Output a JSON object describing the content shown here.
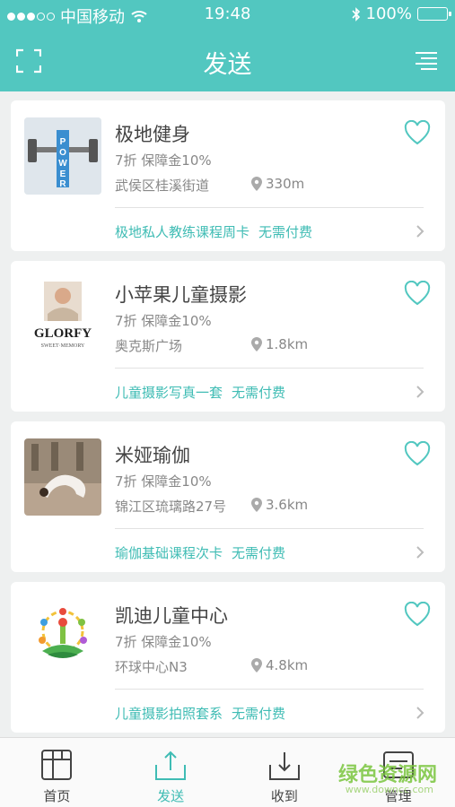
{
  "status_bar": {
    "carrier": "中国移动",
    "time": "19:48",
    "battery": "100%"
  },
  "header": {
    "title": "发送",
    "scan_icon": "scan-icon",
    "menu_icon": "menu-icon"
  },
  "colors": {
    "accent": "#52c7c0",
    "link": "#3fbcb4",
    "heart": "#52c7c0"
  },
  "merchants": [
    {
      "name": "极地健身",
      "discount": "7折  保障金10%",
      "address": "武侯区桂溪街道",
      "distance": "330m",
      "offer": "极地私人教练课程周卡",
      "fee": "无需付费",
      "thumb": "power-logo"
    },
    {
      "name": "小苹果儿童摄影",
      "discount": "7折  保障金10%",
      "address": "奥克斯广场",
      "distance": "1.8km",
      "offer": "儿童摄影写真一套",
      "fee": "无需付费",
      "thumb": "glorfy-logo",
      "thumb_text": "GLORFY",
      "thumb_sub": "SWEET·MEMORY"
    },
    {
      "name": "米娅瑜伽",
      "discount": "7折  保障金10%",
      "address": "锦江区琉璃路27号",
      "distance": "3.6km",
      "offer": "瑜伽基础课程次卡",
      "fee": "无需付费",
      "thumb": "yoga-photo"
    },
    {
      "name": "凯迪儿童中心",
      "discount": "7折  保障金10%",
      "address": "环球中心N3",
      "distance": "4.8km",
      "offer": "儿童摄影拍照套系",
      "fee": "无需付费",
      "thumb": "kids-logo"
    }
  ],
  "tabs": [
    {
      "label": "首页",
      "icon": "home-icon",
      "active": false
    },
    {
      "label": "发送",
      "icon": "send-icon",
      "active": true
    },
    {
      "label": "收到",
      "icon": "receive-icon",
      "active": false
    },
    {
      "label": "管理",
      "icon": "manage-icon",
      "active": false
    }
  ],
  "watermark": {
    "text": "绿色资源网",
    "sub": "www.downcc.com"
  }
}
